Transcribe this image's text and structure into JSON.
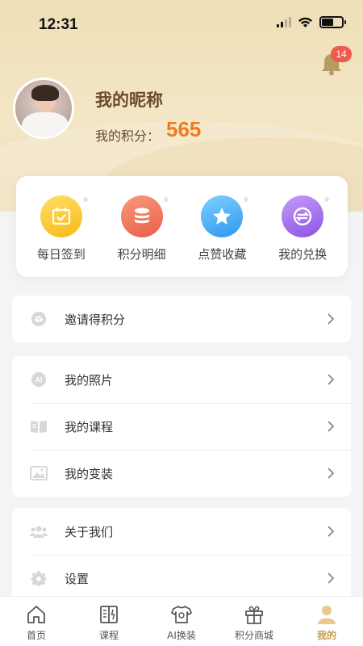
{
  "status": {
    "time": "12:31"
  },
  "notifications": {
    "count": "14"
  },
  "profile": {
    "nickname": "我的昵称",
    "points_label": "我的积分：",
    "points_value": "565"
  },
  "quick_actions": [
    {
      "label": "每日签到",
      "icon": "calendar-check-icon",
      "color": "#f7b918"
    },
    {
      "label": "积分明细",
      "icon": "coin-stack-icon",
      "color": "#ea5d4a"
    },
    {
      "label": "点赞收藏",
      "icon": "star-icon",
      "color": "#2d97ef"
    },
    {
      "label": "我的兑换",
      "icon": "exchange-icon",
      "color": "#8a53e3"
    }
  ],
  "menu_groups": [
    [
      {
        "label": "邀请得积分",
        "icon": "envelope-icon"
      }
    ],
    [
      {
        "label": "我的照片",
        "icon": "ai-icon"
      },
      {
        "label": "我的课程",
        "icon": "book-icon"
      },
      {
        "label": "我的变装",
        "icon": "image-icon"
      }
    ],
    [
      {
        "label": "关于我们",
        "icon": "users-icon"
      },
      {
        "label": "设置",
        "icon": "gear-icon"
      }
    ]
  ],
  "tabs": [
    {
      "label": "首页",
      "icon": "home-icon"
    },
    {
      "label": "课程",
      "icon": "course-book-icon"
    },
    {
      "label": "AI换装",
      "icon": "tshirt-icon"
    },
    {
      "label": "积分商城",
      "icon": "gift-icon"
    },
    {
      "label": "我的",
      "icon": "profile-icon",
      "active": true
    }
  ],
  "colors": {
    "accent": "#f07a1c",
    "brand_brown": "#6b4a2e",
    "active_tab": "#c79a4a",
    "badge": "#ee5a4c"
  }
}
